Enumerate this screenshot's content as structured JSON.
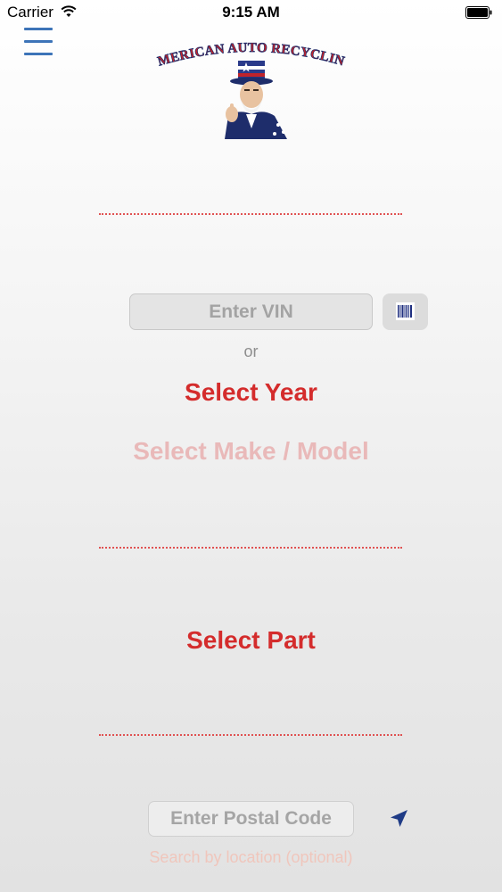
{
  "status_bar": {
    "carrier": "Carrier",
    "time": "9:15 AM",
    "wifi_icon": "wifi-icon",
    "battery_icon": "battery-icon"
  },
  "header": {
    "menu_icon": "hamburger-menu-icon",
    "logo_text": "AMERICAN AUTO RECYCLING",
    "logo_icon": "uncle-sam-logo"
  },
  "vin": {
    "placeholder": "Enter VIN",
    "value": "",
    "scan_icon": "barcode-icon"
  },
  "or_label": "or",
  "selectors": {
    "year": "Select Year",
    "make_model": "Select Make / Model",
    "part": "Select Part"
  },
  "location": {
    "postal_placeholder": "Enter Postal Code",
    "postal_value": "",
    "locate_icon": "location-arrow-icon",
    "hint": "Search by location (optional)"
  },
  "colors": {
    "accent_red": "#d42c2c",
    "disabled_red": "#e9b9b9",
    "menu_blue": "#3d74b8",
    "location_navy": "#1f3b86"
  }
}
